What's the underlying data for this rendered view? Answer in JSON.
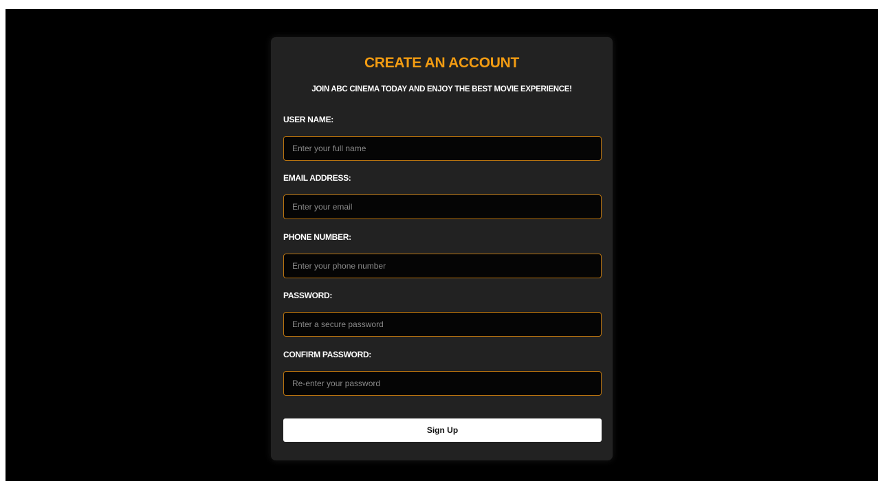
{
  "form": {
    "title": "CREATE AN ACCOUNT",
    "subtitle": "JOIN ABC CINEMA TODAY AND ENJOY THE BEST MOVIE EXPERIENCE!",
    "fields": [
      {
        "label": "USER NAME:",
        "placeholder": "Enter your full name",
        "value": ""
      },
      {
        "label": "EMAIL ADDRESS:",
        "placeholder": "Enter your email",
        "value": ""
      },
      {
        "label": "PHONE NUMBER:",
        "placeholder": "Enter your phone number",
        "value": ""
      },
      {
        "label": "PASSWORD:",
        "placeholder": "Enter a secure password",
        "value": ""
      },
      {
        "label": "CONFIRM PASSWORD:",
        "placeholder": "Re-enter your password",
        "value": ""
      }
    ],
    "submit_label": "Sign Up"
  },
  "colors": {
    "accent": "#f39c12",
    "card_background": "#222222",
    "page_background": "#000000",
    "input_border": "#b8730f"
  }
}
